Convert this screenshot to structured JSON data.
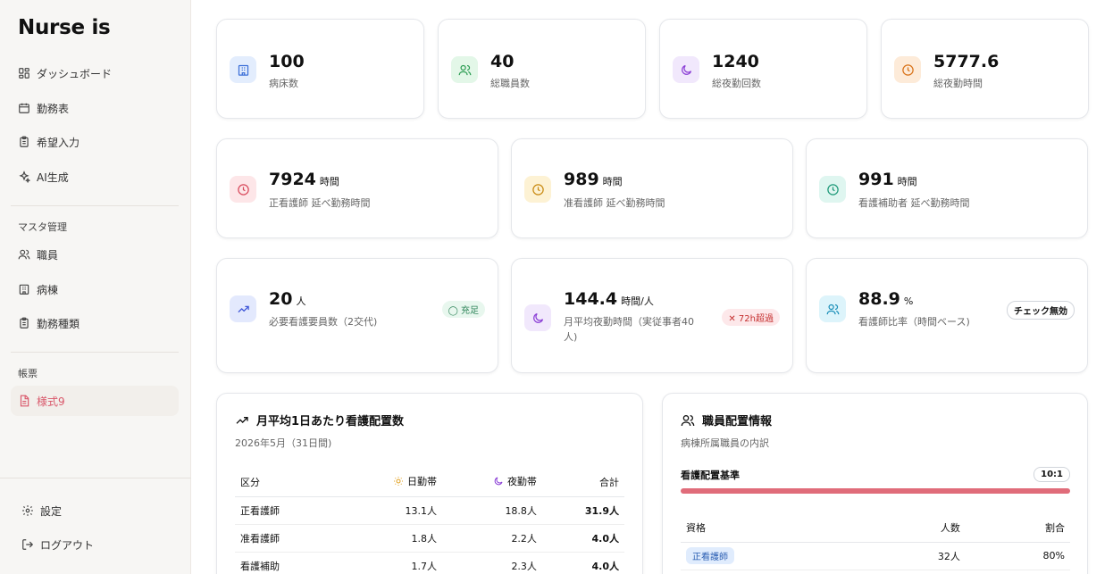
{
  "app": {
    "logo": "Nurse is"
  },
  "sidebar": {
    "items": [
      {
        "label": "ダッシュボード",
        "icon": "dashboard-icon"
      },
      {
        "label": "勤務表",
        "icon": "calendar-icon"
      },
      {
        "label": "希望入力",
        "icon": "clipboard-icon"
      },
      {
        "label": "AI生成",
        "icon": "sparkles-icon"
      }
    ],
    "master_label": "マスタ管理",
    "master_items": [
      {
        "label": "職員",
        "icon": "users-icon"
      },
      {
        "label": "病棟",
        "icon": "building-icon"
      },
      {
        "label": "勤務種類",
        "icon": "clipboard-icon"
      }
    ],
    "forms_label": "帳票",
    "forms_items": [
      {
        "label": "様式9",
        "icon": "document-icon",
        "active": true
      }
    ],
    "settings_label": "設定",
    "logout_label": "ログアウト"
  },
  "stats_row1": [
    {
      "value": "100",
      "label": "病床数",
      "icon": "building-icon",
      "color": "#e3edfd",
      "fg": "#3b6fd8"
    },
    {
      "value": "40",
      "label": "総職員数",
      "icon": "users-icon",
      "color": "#e3f7e8",
      "fg": "#2f9e55"
    },
    {
      "value": "1240",
      "label": "総夜勤回数",
      "icon": "moon-icon",
      "color": "#f1e8fc",
      "fg": "#8b3fd6"
    },
    {
      "value": "5777.6",
      "label": "総夜勤時間",
      "icon": "clock-icon",
      "color": "#fdebd9",
      "fg": "#d9731a"
    }
  ],
  "stats_row2": [
    {
      "value": "7924",
      "unit": "時間",
      "label": "正看護師 延べ勤務時間",
      "icon": "clock-icon",
      "color": "#fde6e8",
      "fg": "#d84a5c"
    },
    {
      "value": "989",
      "unit": "時間",
      "label": "准看護師 延べ勤務時間",
      "icon": "clock-icon",
      "color": "#fdf2d4",
      "fg": "#c98a12"
    },
    {
      "value": "991",
      "unit": "時間",
      "label": "看護補助者 延べ勤務時間",
      "icon": "clock-icon",
      "color": "#dff6f0",
      "fg": "#1f9a7a"
    }
  ],
  "stats_row3": [
    {
      "value": "20",
      "unit": "人",
      "label": "必要看護要員数（2交代)",
      "icon": "trend-up-icon",
      "color": "#e3e9fd",
      "fg": "#4058d8",
      "badge": "◯ 充足"
    },
    {
      "value": "144.4",
      "unit": "時間/人",
      "label": "月平均夜勤時間（実従事者40",
      "label2": "人)",
      "icon": "moon-icon",
      "color": "#f1e8fc",
      "fg": "#8b3fd6",
      "badge": "✕ 72h超過"
    },
    {
      "value": "88.9",
      "unit": "%",
      "label": "看護師比率（時間ベース)",
      "icon": "users-icon",
      "color": "#ddf4fb",
      "fg": "#1b8fb8",
      "badge": "チェック無効"
    }
  ],
  "placement_panel": {
    "title": "月平均1日あたり看護配置数",
    "subtitle": "2026年5月（31日間)",
    "headers": [
      "区分",
      "日勤帯",
      "夜勤帯",
      "合計"
    ],
    "rows": [
      [
        "正看護師",
        "13.1人",
        "18.8人",
        "31.9人"
      ],
      [
        "准看護師",
        "1.8人",
        "2.2人",
        "4.0人"
      ],
      [
        "看護補助",
        "1.7人",
        "2.3人",
        "4.0人"
      ]
    ]
  },
  "staff_panel": {
    "title": "職員配置情報",
    "subtitle": "病棟所属職員の内訳",
    "standard_label": "看護配置基準",
    "standard_value": "10:1",
    "headers": [
      "資格",
      "人数",
      "割合"
    ],
    "rows": [
      [
        "正看護師",
        "32人",
        "80%"
      ]
    ]
  }
}
